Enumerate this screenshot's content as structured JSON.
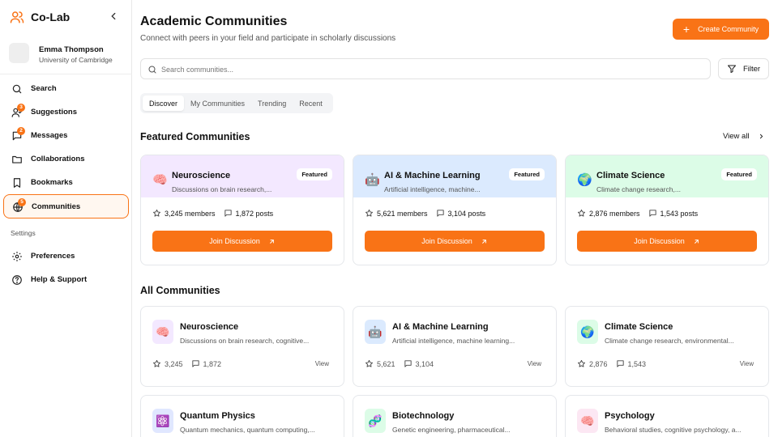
{
  "app": {
    "name": "Co-Lab"
  },
  "user": {
    "name": "Emma Thompson",
    "org": "University of Cambridge"
  },
  "sidebar": {
    "items": [
      {
        "label": "Search",
        "icon": "search-icon"
      },
      {
        "label": "Suggestions",
        "icon": "user-check-icon",
        "badge": "3"
      },
      {
        "label": "Messages",
        "icon": "message-icon",
        "badge": "2"
      },
      {
        "label": "Collaborations",
        "icon": "folder-icon"
      },
      {
        "label": "Bookmarks",
        "icon": "bookmark-icon"
      },
      {
        "label": "Communities",
        "icon": "globe-icon",
        "badge": "5",
        "active": true
      }
    ],
    "settings_label": "Settings",
    "settings_items": [
      {
        "label": "Preferences",
        "icon": "gear-icon"
      },
      {
        "label": "Help & Support",
        "icon": "help-icon"
      }
    ]
  },
  "header": {
    "title": "Academic Communities",
    "subtitle": "Connect with peers in your field and participate in scholarly discussions",
    "create_label": "Create Community"
  },
  "search": {
    "placeholder": "Search communities...",
    "value": ""
  },
  "filter_label": "Filter",
  "tabs": [
    "Discover",
    "My Communities",
    "Trending",
    "Recent"
  ],
  "featured": {
    "title": "Featured Communities",
    "view_all": "View all",
    "badge": "Featured",
    "join_label": "Join Discussion",
    "cards": [
      {
        "emoji": "🧠",
        "name": "Neuroscience",
        "desc": "Discussions on brain research,...",
        "members": "3,245 members",
        "posts": "1,872 posts",
        "color": "#f3e8ff"
      },
      {
        "emoji": "🤖",
        "name": "AI & Machine Learning",
        "desc": "Artificial intelligence, machine...",
        "members": "5,621 members",
        "posts": "3,104 posts",
        "color": "#dbeafe"
      },
      {
        "emoji": "🌍",
        "name": "Climate Science",
        "desc": "Climate change research,...",
        "members": "2,876 members",
        "posts": "1,543 posts",
        "color": "#dcfce7"
      }
    ]
  },
  "all": {
    "title": "All Communities",
    "view_label": "View",
    "cards": [
      {
        "emoji": "🧠",
        "name": "Neuroscience",
        "desc": "Discussions on brain research, cognitive...",
        "members": "3,245",
        "posts": "1,872",
        "color": "#f3e8ff"
      },
      {
        "emoji": "🤖",
        "name": "AI & Machine Learning",
        "desc": "Artificial intelligence, machine learning...",
        "members": "5,621",
        "posts": "3,104",
        "color": "#dbeafe"
      },
      {
        "emoji": "🌍",
        "name": "Climate Science",
        "desc": "Climate change research, environmental...",
        "members": "2,876",
        "posts": "1,543",
        "color": "#dcfce7"
      },
      {
        "emoji": "⚛️",
        "name": "Quantum Physics",
        "desc": "Quantum mechanics, quantum computing,...",
        "color": "#e0e7ff"
      },
      {
        "emoji": "🧬",
        "name": "Biotechnology",
        "desc": "Genetic engineering, pharmaceutical...",
        "color": "#dcfce7"
      },
      {
        "emoji": "🧠",
        "name": "Psychology",
        "desc": "Behavioral studies, cognitive psychology, a...",
        "color": "#fce7f3"
      }
    ]
  },
  "colors": {
    "accent": "#f97316"
  }
}
